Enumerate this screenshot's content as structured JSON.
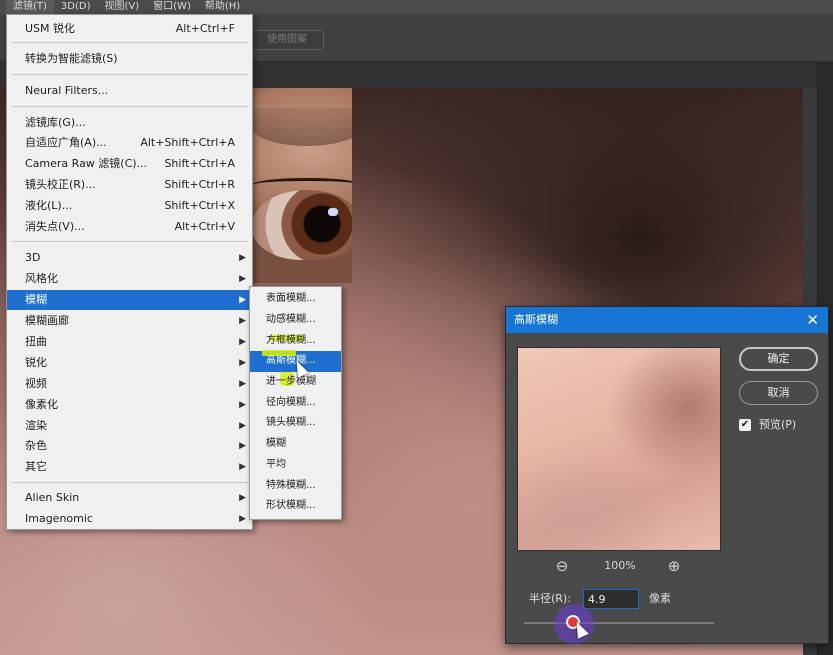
{
  "menubar": {
    "items": [
      "滤镜(T)",
      "3D(D)",
      "视图(V)",
      "窗口(W)",
      "帮助(H)"
    ]
  },
  "options_bar": {
    "button_label": "使用图案"
  },
  "filter_menu": {
    "items": [
      {
        "label": "USM 锐化",
        "shortcut": "Alt+Ctrl+F"
      },
      {
        "label": "转换为智能滤镜(S)",
        "shortcut": ""
      },
      {
        "label": "Neural Filters...",
        "shortcut": ""
      },
      {
        "label": "滤镜库(G)...",
        "shortcut": ""
      },
      {
        "label": "自适应广角(A)...",
        "shortcut": "Alt+Shift+Ctrl+A"
      },
      {
        "label": "Camera Raw 滤镜(C)...",
        "shortcut": "Shift+Ctrl+A"
      },
      {
        "label": "镜头校正(R)...",
        "shortcut": "Shift+Ctrl+R"
      },
      {
        "label": "液化(L)...",
        "shortcut": "Shift+Ctrl+X"
      },
      {
        "label": "消失点(V)...",
        "shortcut": "Alt+Ctrl+V"
      },
      {
        "label": "3D"
      },
      {
        "label": "风格化"
      },
      {
        "label": "模糊"
      },
      {
        "label": "模糊画廊"
      },
      {
        "label": "扭曲"
      },
      {
        "label": "锐化"
      },
      {
        "label": "视频"
      },
      {
        "label": "像素化"
      },
      {
        "label": "渲染"
      },
      {
        "label": "杂色"
      },
      {
        "label": "其它"
      },
      {
        "label": "Alien Skin"
      },
      {
        "label": "Imagenomic"
      }
    ]
  },
  "blur_submenu": {
    "items": [
      "表面模糊...",
      "动感模糊...",
      "方框模糊...",
      "高斯模糊...",
      "进一步模糊",
      "径向模糊...",
      "镜头模糊...",
      "模糊",
      "平均",
      "特殊模糊...",
      "形状模糊..."
    ]
  },
  "dialog": {
    "title": "高斯模糊",
    "ok_label": "确定",
    "cancel_label": "取消",
    "preview_label": "预览(P)",
    "preview_checked": true,
    "zoom": "100%",
    "radius_label": "半径(R):",
    "radius_value": "4.9",
    "radius_unit": "像素"
  },
  "icons": {
    "close": "close-icon",
    "zoom_out": "zoom-out-icon",
    "zoom_in": "zoom-in-icon",
    "checkbox": "checkmark-icon",
    "submenu": "chevron-right-icon"
  },
  "colors": {
    "highlight": "#1f6fd1",
    "dialog_title": "#1775d6",
    "slider_thumb": "#e23838"
  }
}
